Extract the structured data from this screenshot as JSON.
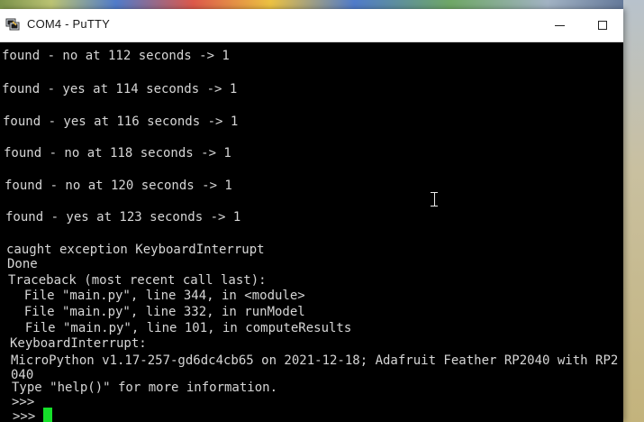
{
  "window": {
    "title": "COM4 - PuTTY",
    "app_icon": "putty-icon",
    "controls": {
      "minimize_icon": "minimize-icon",
      "maximize_icon": "maximize-icon"
    }
  },
  "terminal": {
    "lines": [
      "found - no at 112 seconds -> 1",
      "found - yes at 114 seconds -> 1",
      "found - yes at 116 seconds -> 1",
      "found - no at 118 seconds -> 1",
      "found - no at 120 seconds -> 1",
      "found - yes at 123 seconds -> 1",
      "caught exception KeyboardInterrupt",
      "Done",
      "Traceback (most recent call last):",
      "  File \"main.py\", line 344, in <module>",
      "  File \"main.py\", line 332, in runModel",
      "  File \"main.py\", line 101, in computeResults",
      "KeyboardInterrupt:",
      "MicroPython v1.17-257-gd6dc4cb65 on 2021-12-18; Adafruit Feather RP2040 with RP2",
      "040",
      "Type \"help()\" for more information.",
      ">>>",
      ">>> "
    ],
    "cursor_color": "#15e02a",
    "text_color": "#d6d6d6",
    "background_color": "#000000"
  }
}
